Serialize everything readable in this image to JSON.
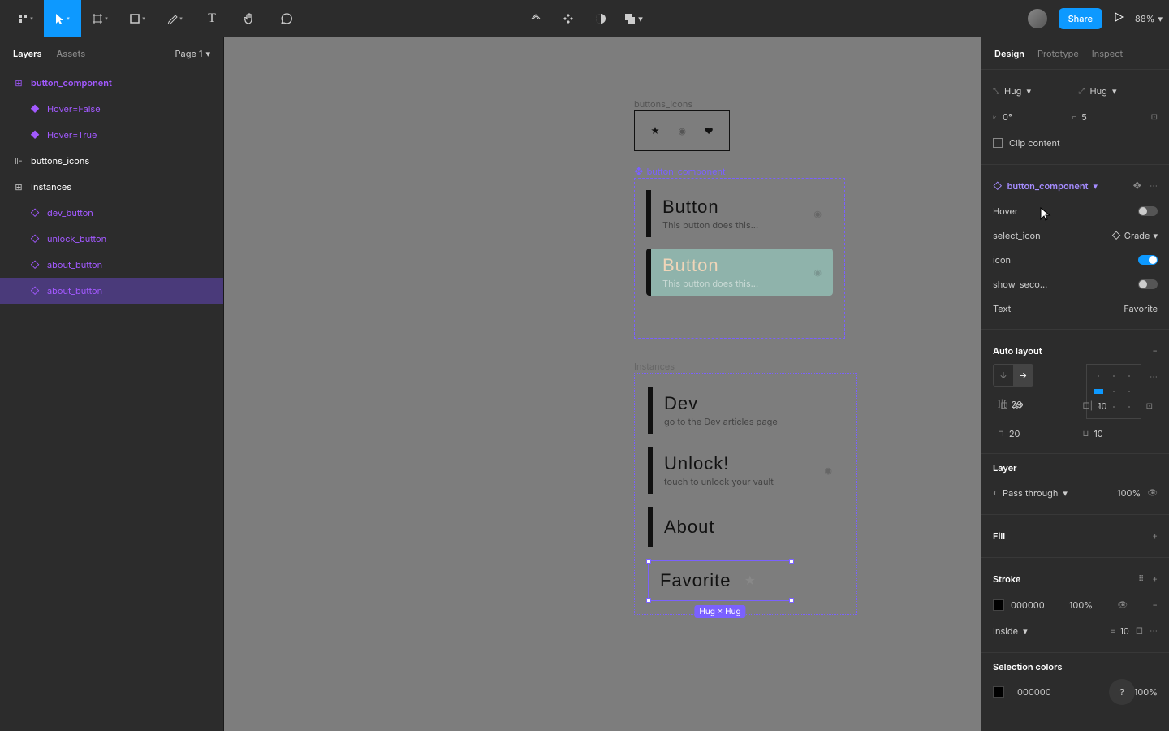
{
  "toolbar": {
    "share": "Share",
    "zoom": "88%"
  },
  "leftPanel": {
    "tabs": {
      "layers": "Layers",
      "assets": "Assets"
    },
    "page": "Page 1",
    "items": [
      {
        "label": "button_component"
      },
      {
        "label": "Hover=False"
      },
      {
        "label": "Hover=True"
      },
      {
        "label": "buttons_icons"
      },
      {
        "label": "Instances"
      },
      {
        "label": "dev_button"
      },
      {
        "label": "unlock_button"
      },
      {
        "label": "about_button"
      },
      {
        "label": "about_button"
      }
    ]
  },
  "canvas": {
    "iconsFrameLabel": "buttons_icons",
    "compFrameLabel": "button_component",
    "instFrameLabel": "Instances",
    "defaultBtn": {
      "title": "Button",
      "sub": "This button does this..."
    },
    "hoverBtn": {
      "title": "Button",
      "sub": "This button does this..."
    },
    "inst": [
      {
        "title": "Dev",
        "sub": "go to the Dev articles page"
      },
      {
        "title": "Unlock!",
        "sub": "touch to unlock your vault"
      },
      {
        "title": "About",
        "sub": ""
      },
      {
        "title": "Favorite",
        "sub": ""
      }
    ],
    "sizeBadge": "Hug × Hug"
  },
  "rightPanel": {
    "tabs": {
      "design": "Design",
      "prototype": "Prototype",
      "inspect": "Inspect"
    },
    "resize": {
      "w": "Hug",
      "h": "Hug"
    },
    "rotation": "0°",
    "radius": "5",
    "clip": "Clip content",
    "componentName": "button_component",
    "props": {
      "hover": {
        "label": "Hover"
      },
      "selectIcon": {
        "label": "select_icon",
        "value": "Grade"
      },
      "icon": {
        "label": "icon"
      },
      "showSecond": {
        "label": "show_seco..."
      },
      "text": {
        "label": "Text",
        "value": "Favorite"
      }
    },
    "autoLayout": {
      "title": "Auto layout",
      "gap": "29",
      "pl": "32",
      "pr": "10",
      "pt": "20",
      "pb": "10"
    },
    "layer": {
      "title": "Layer",
      "blend": "Pass through",
      "opacity": "100%"
    },
    "fill": {
      "title": "Fill"
    },
    "stroke": {
      "title": "Stroke",
      "hex": "000000",
      "opacity": "100%",
      "pos": "Inside",
      "width": "10"
    },
    "selColors": {
      "title": "Selection colors",
      "hex": "000000",
      "opacity": "100%"
    }
  }
}
